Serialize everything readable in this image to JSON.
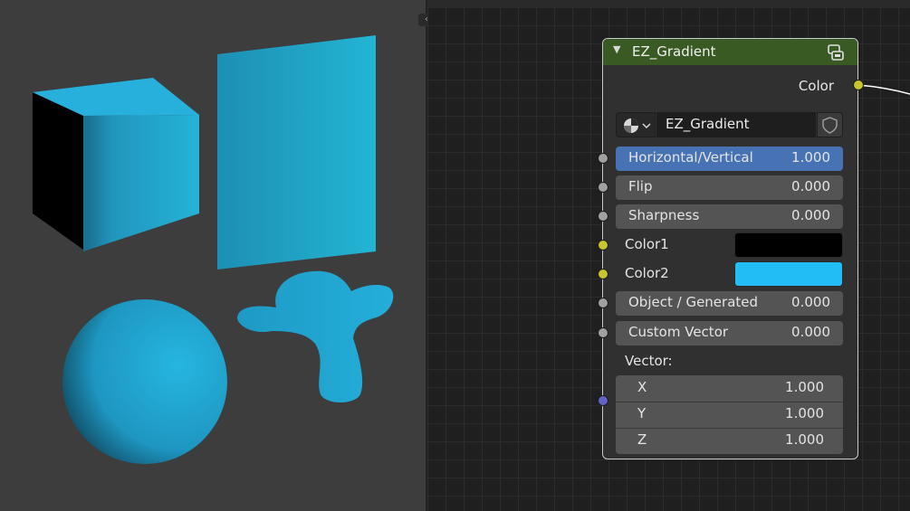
{
  "viewport": {
    "objects": [
      "cube",
      "plane",
      "sphere",
      "monkey"
    ],
    "gradient_colors": {
      "dark": "#000000",
      "light": "#23bdf5"
    }
  },
  "node": {
    "title": "EZ_Gradient",
    "header_color": "#3a5a24",
    "output": {
      "label": "Color",
      "socket_color": "#c7c729"
    },
    "group_selector": {
      "name": "EZ_Gradient"
    },
    "inputs": [
      {
        "label": "Horizontal/Vertical",
        "value": "1.000",
        "active": true
      },
      {
        "label": "Flip",
        "value": "0.000"
      },
      {
        "label": "Sharpness",
        "value": "0.000"
      }
    ],
    "colors": [
      {
        "label": "Color1",
        "swatch": "#000000"
      },
      {
        "label": "Color2",
        "swatch": "#23bdf5"
      }
    ],
    "inputs2": [
      {
        "label": "Object / Generated",
        "value": "0.000"
      },
      {
        "label": "Custom Vector",
        "value": "0.000"
      }
    ],
    "vector": {
      "label": "Vector:",
      "rows": [
        {
          "axis": "X",
          "value": "1.000"
        },
        {
          "axis": "Y",
          "value": "1.000"
        },
        {
          "axis": "Z",
          "value": "1.000"
        }
      ]
    }
  }
}
